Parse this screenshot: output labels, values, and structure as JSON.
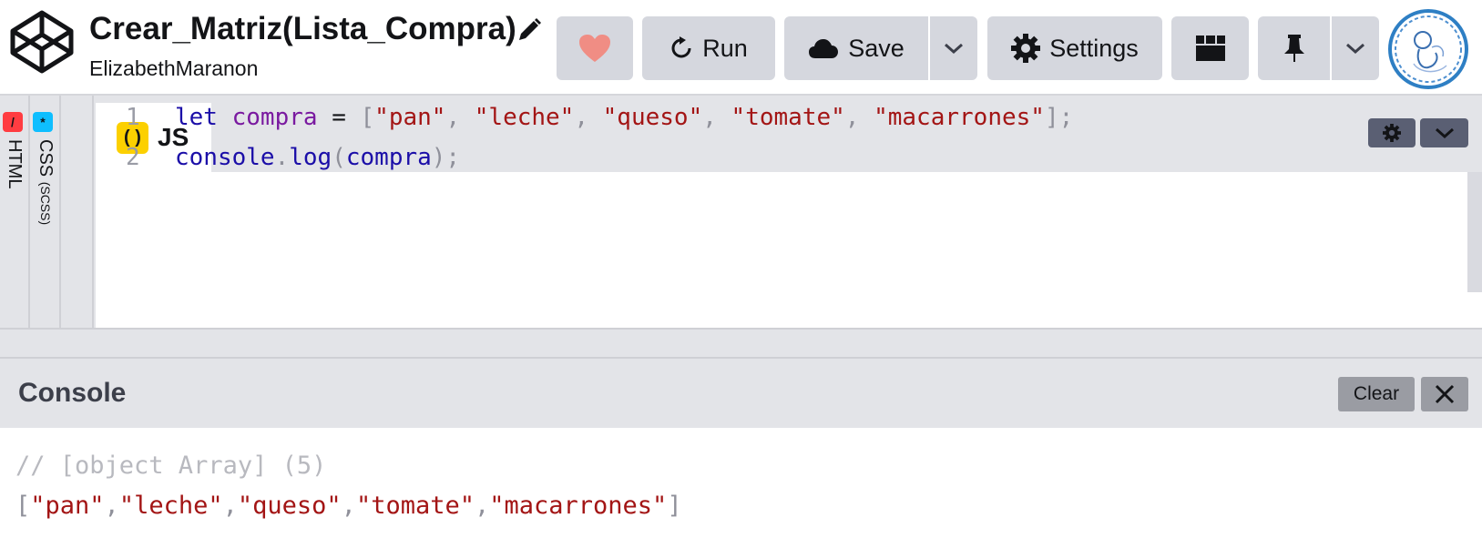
{
  "header": {
    "title": "Crear_Matriz(Lista_Compra)",
    "author": "ElizabethMaranon",
    "buttons": {
      "run": "Run",
      "save": "Save",
      "settings": "Settings"
    },
    "icons": {
      "logo": "codepen-logo",
      "edit": "pencil-icon",
      "heart": "heart-icon",
      "run": "refresh-icon",
      "save": "cloud-icon",
      "settings": "gear-icon",
      "layout": "layout-icon",
      "pin": "pin-icon",
      "dropdown": "chevron-down-icon"
    },
    "colors": {
      "heart": "#f08d84",
      "button_bg": "#d5d7de"
    }
  },
  "editor": {
    "side_tabs": [
      {
        "label": "HTML",
        "badge": "/",
        "color": "#ff3c41"
      },
      {
        "label": "CSS",
        "sub": "(SCSS)",
        "badge": "*",
        "color": "#0ebeff"
      }
    ],
    "active_tab": {
      "label": "JS",
      "badge": "( )",
      "color": "#fcd000"
    },
    "code": {
      "line_numbers": [
        "1",
        "2"
      ],
      "line1": {
        "kw": "let",
        "var": "compra",
        "op": " = ",
        "open": "[",
        "s1": "\"pan\"",
        "s2": "\"leche\"",
        "s3": "\"queso\"",
        "s4": "\"tomate\"",
        "s5": "\"macarrones\"",
        "comma": ", ",
        "close": "];"
      },
      "line2": {
        "obj": "console",
        "dot": ".",
        "method": "log",
        "open": "(",
        "arg": "compra",
        "close": ");"
      }
    }
  },
  "console": {
    "title": "Console",
    "clear_label": "Clear",
    "comment": "// [object Array] (5)",
    "output": {
      "open": "[",
      "items": [
        "\"pan\"",
        "\"leche\"",
        "\"queso\"",
        "\"tomate\"",
        "\"macarrones\""
      ],
      "sep": ",",
      "close": "]"
    }
  }
}
